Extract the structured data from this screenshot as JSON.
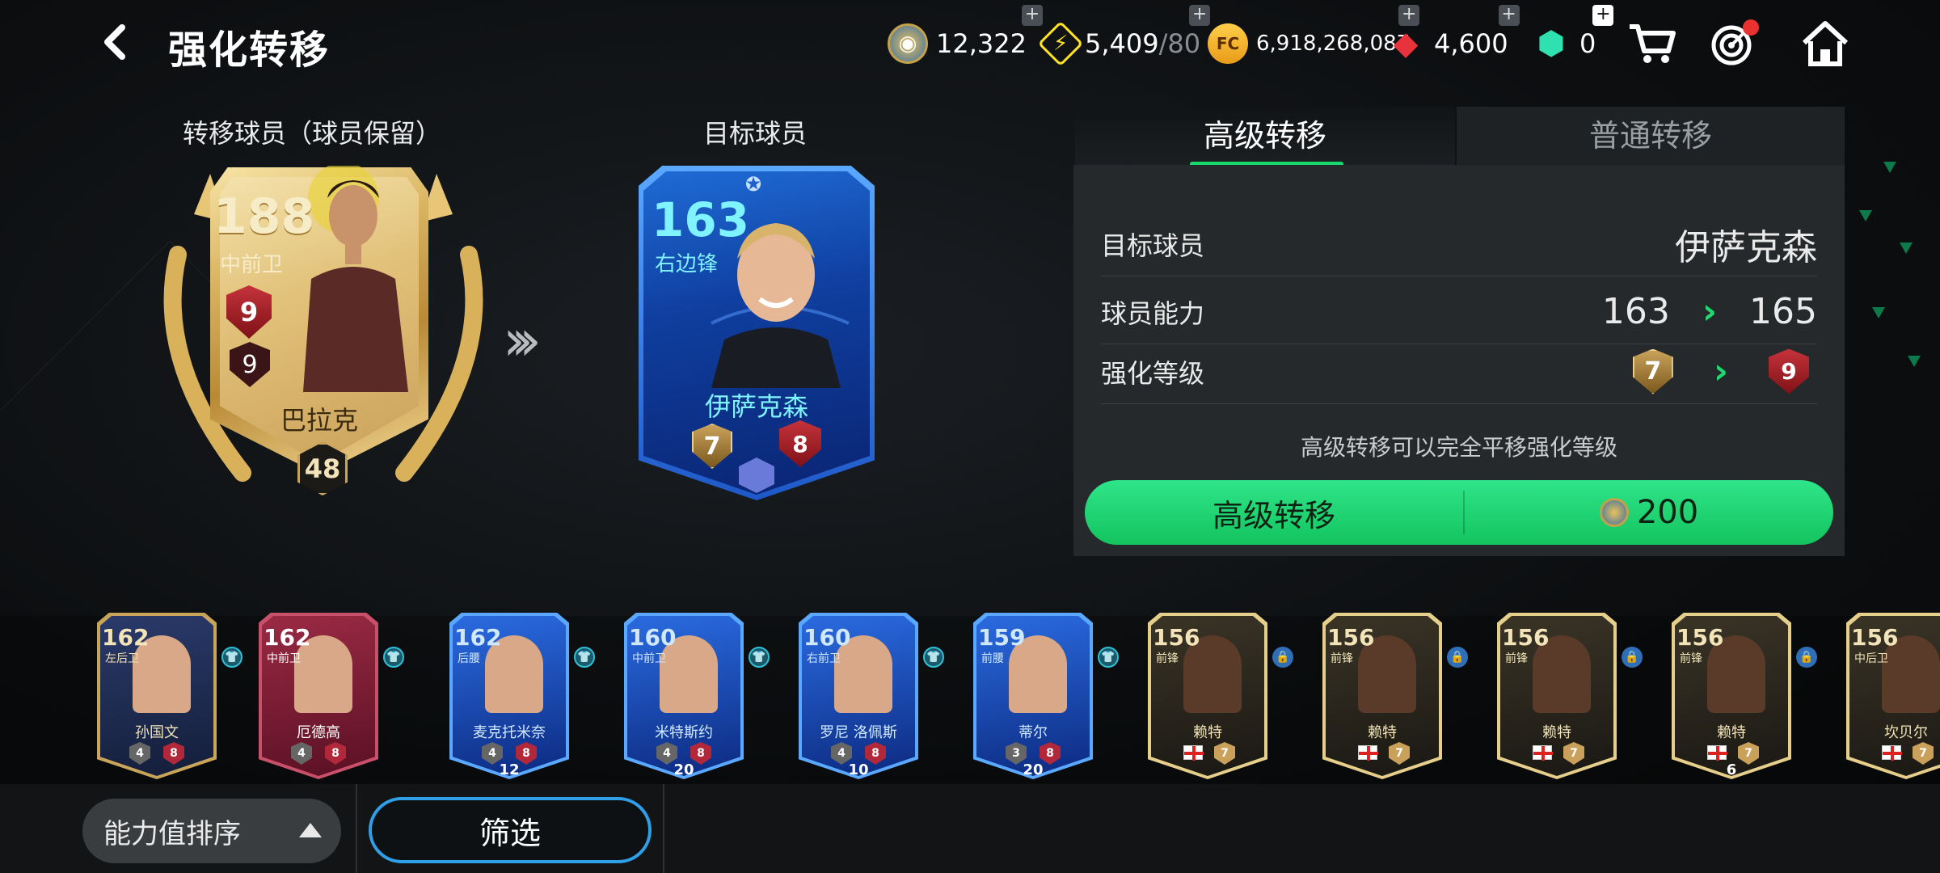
{
  "header": {
    "title": "强化转移",
    "currencies": [
      {
        "icon": "token-coin-icon",
        "value": "12,322",
        "max": ""
      },
      {
        "icon": "energy-icon",
        "value": "5,409",
        "max": "/80"
      },
      {
        "icon": "fc-points-icon",
        "value": "6,918,268,087",
        "max": ""
      },
      {
        "icon": "gem-icon",
        "value": "4,600",
        "max": ""
      },
      {
        "icon": "green-gem-icon",
        "value": "0",
        "max": ""
      }
    ]
  },
  "left_section": {
    "source_label": "转移球员（球员保留）",
    "target_label": "目标球员"
  },
  "source_card": {
    "rating": "188",
    "position": "中前卫",
    "training_level": "9",
    "rank_level": "9",
    "name": "巴拉克",
    "level_badge": "48"
  },
  "target_card": {
    "rating": "163",
    "position": "右边锋",
    "name": "伊萨克森",
    "training_level": "7",
    "rank_level": "8"
  },
  "tabs": {
    "active": "高级转移",
    "inactive": "普通转移"
  },
  "panel": {
    "rows": [
      {
        "label": "目标球员",
        "value": "伊萨克森"
      },
      {
        "label": "球员能力",
        "from": "163",
        "to": "165"
      },
      {
        "label": "强化等级",
        "from": "7",
        "to": "9"
      }
    ],
    "note": "高级转移可以完全平移强化等级",
    "button_label": "高级转移",
    "button_cost": "200"
  },
  "strip": [
    {
      "rating": "162",
      "pos": "左后卫",
      "name": "孙国文",
      "lvl": "4",
      "rank": "8",
      "count": "",
      "style": "navy"
    },
    {
      "rating": "162",
      "pos": "中前卫",
      "name": "厄德高",
      "lvl": "4",
      "rank": "8",
      "count": "",
      "style": "wine"
    },
    {
      "rating": "162",
      "pos": "后腰",
      "name": "麦克托米奈",
      "lvl": "4",
      "rank": "8",
      "count": "12",
      "style": "blue"
    },
    {
      "rating": "160",
      "pos": "中前卫",
      "name": "米特斯约",
      "lvl": "4",
      "rank": "8",
      "count": "20",
      "style": "blue"
    },
    {
      "rating": "160",
      "pos": "右前卫",
      "name": "罗尼 洛佩斯",
      "lvl": "4",
      "rank": "8",
      "count": "10",
      "style": "blue"
    },
    {
      "rating": "159",
      "pos": "前腰",
      "name": "蒂尔",
      "lvl": "3",
      "rank": "8",
      "count": "20",
      "style": "blue"
    },
    {
      "rating": "156",
      "pos": "前锋",
      "name": "赖特",
      "lvl": "",
      "rank": "7",
      "count": "",
      "style": "gold"
    },
    {
      "rating": "156",
      "pos": "前锋",
      "name": "赖特",
      "lvl": "",
      "rank": "7",
      "count": "",
      "style": "gold"
    },
    {
      "rating": "156",
      "pos": "前锋",
      "name": "赖特",
      "lvl": "",
      "rank": "7",
      "count": "",
      "style": "gold"
    },
    {
      "rating": "156",
      "pos": "前锋",
      "name": "赖特",
      "lvl": "",
      "rank": "7",
      "count": "6",
      "style": "gold"
    },
    {
      "rating": "156",
      "pos": "中后卫",
      "name": "坎贝尔",
      "lvl": "",
      "rank": "7",
      "count": "",
      "style": "gold"
    }
  ],
  "bottom": {
    "sort_label": "能力值排序",
    "filter_label": "筛选"
  },
  "colors": {
    "accent_green": "#17d86b",
    "filter_blue": "#2f9fe8"
  }
}
